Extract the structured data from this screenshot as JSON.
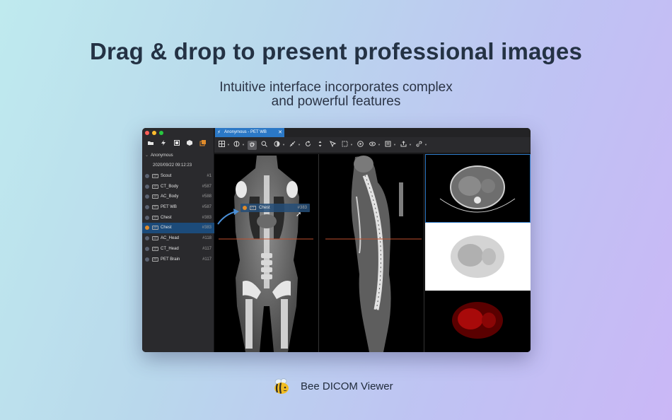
{
  "headline": "Drag & drop to present professional images",
  "subheadline": {
    "line1": "Intuitive interface incorporates complex",
    "line2": "and powerful features"
  },
  "app": {
    "tab_title": "Anonymous - PET WB",
    "sidebar": {
      "patient": "Anonymous",
      "study_date": "2020/09/22 09:12:23",
      "series": [
        {
          "modality": "CT",
          "name": "Scout",
          "count": "#1",
          "selected": false
        },
        {
          "modality": "CT",
          "name": "CT_Body",
          "count": "#587",
          "selected": false
        },
        {
          "modality": "CT",
          "name": "AC_Body",
          "count": "#588",
          "selected": false
        },
        {
          "modality": "PT",
          "name": "PET WB",
          "count": "#587",
          "selected": false
        },
        {
          "modality": "CT",
          "name": "Chest",
          "count": "#383",
          "selected": false
        },
        {
          "modality": "CT",
          "name": "Chest",
          "count": "#383",
          "selected": true
        },
        {
          "modality": "CT",
          "name": "AC_Head",
          "count": "#118",
          "selected": false
        },
        {
          "modality": "CT",
          "name": "CT_Head",
          "count": "#117",
          "selected": false
        },
        {
          "modality": "PT",
          "name": "PET Brain",
          "count": "#117",
          "selected": false
        }
      ]
    },
    "drag_item": {
      "modality": "CT",
      "name": "Chest",
      "count": "#383"
    },
    "toolbar_icons": [
      "layout-icon",
      "window-level-icon",
      "pan-icon",
      "zoom-icon",
      "contrast-icon",
      "measure-icon",
      "rotate-icon",
      "flip-icon",
      "roi-icon",
      "select-icon",
      "play-icon",
      "view-icon",
      "annotation-icon",
      "export-icon",
      "link-icon"
    ]
  },
  "brand": {
    "name": "Bee DICOM Viewer"
  },
  "colors": {
    "accent": "#2b78c6",
    "selected_row": "#1c4b7a",
    "sidebar_bg": "#2a2a2d",
    "headline": "#243244"
  }
}
